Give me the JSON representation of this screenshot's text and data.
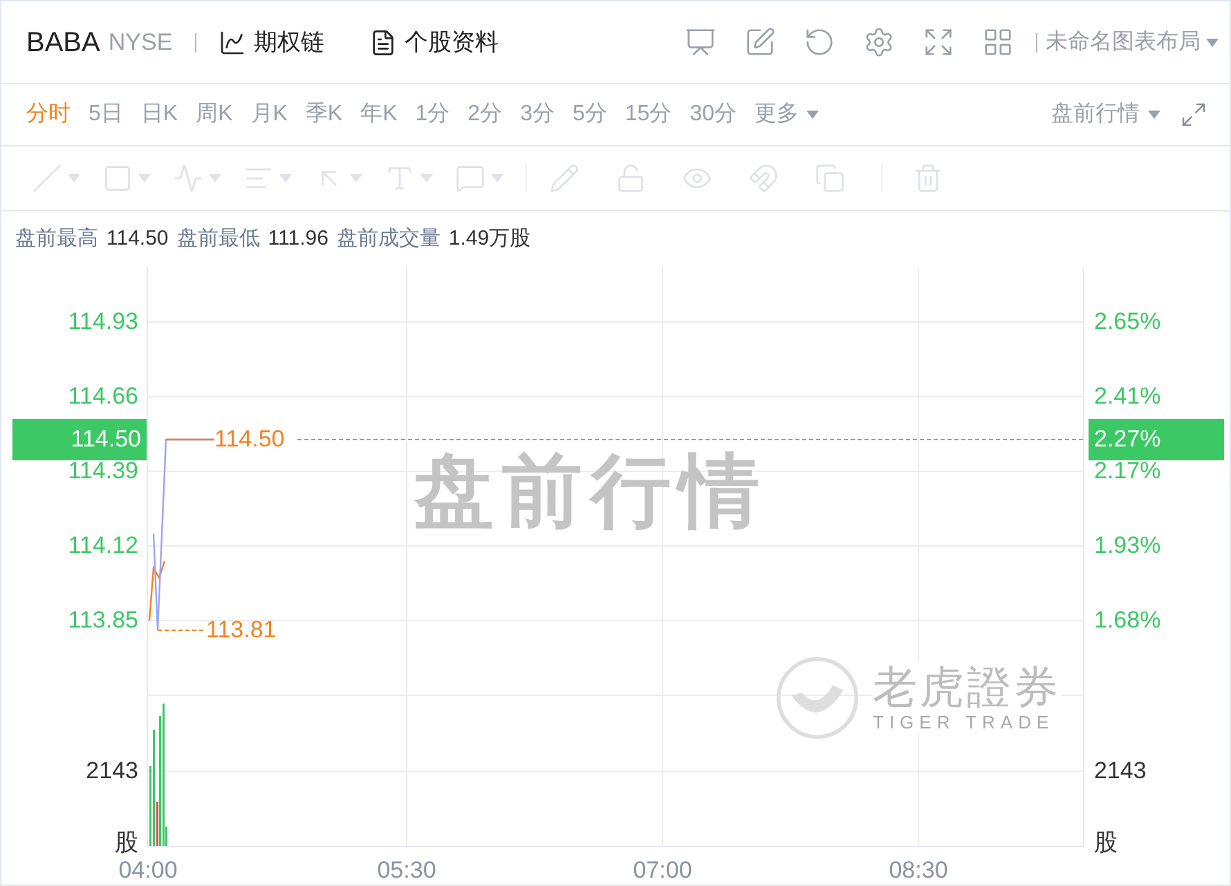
{
  "header": {
    "symbol": "BABA",
    "exchange": "NYSE",
    "links": [
      {
        "label": "期权链",
        "kind": "chain"
      },
      {
        "label": "个股资料",
        "kind": "profile"
      }
    ],
    "layout_menu": "未命名图表布局"
  },
  "periods": [
    {
      "label": "分时",
      "selected": true,
      "kind": "tab"
    },
    {
      "label": "5日",
      "selected": false,
      "kind": "tab"
    },
    {
      "label": "日K",
      "selected": false,
      "kind": "tab"
    },
    {
      "label": "周K",
      "selected": false,
      "kind": "tab"
    },
    {
      "label": "月K",
      "selected": false,
      "kind": "tab"
    },
    {
      "label": "季K",
      "selected": false,
      "kind": "tab"
    },
    {
      "label": "年K",
      "selected": false,
      "kind": "tab"
    },
    {
      "label": "1分",
      "selected": false,
      "kind": "tab"
    },
    {
      "label": "2分",
      "selected": false,
      "kind": "tab"
    },
    {
      "label": "3分",
      "selected": false,
      "kind": "tab"
    },
    {
      "label": "5分",
      "selected": false,
      "kind": "tab"
    },
    {
      "label": "15分",
      "selected": false,
      "kind": "tab"
    },
    {
      "label": "30分",
      "selected": false,
      "kind": "tab"
    },
    {
      "label": "更多",
      "selected": false,
      "kind": "menu"
    }
  ],
  "session_menu": "盘前行情",
  "drawing_toolbar": {
    "disabled": true
  },
  "info": [
    {
      "label": "盘前最高",
      "value": "114.50"
    },
    {
      "label": "盘前最低",
      "value": "111.96"
    },
    {
      "label": "盘前成交量",
      "value": "1.49万股"
    }
  ],
  "chart": {
    "watermark": "盘前行情",
    "brand": "老虎證券",
    "brand_sub": "TIGER TRADE",
    "price_ticks": [
      "114.93",
      "114.66",
      "114.39",
      "114.12",
      "113.85"
    ],
    "percent_ticks": [
      "2.65%",
      "2.41%",
      "2.17%",
      "1.93%",
      "1.68%"
    ],
    "current_price": "114.50",
    "current_percent": "2.27%",
    "high_label": "114.50",
    "low_label": "113.81",
    "left_volume": {
      "tick": "2143",
      "unit": "股"
    },
    "right_volume": {
      "tick": "2143",
      "unit": "股"
    },
    "time_ticks": [
      "04:00",
      "05:30",
      "07:00",
      "08:30"
    ]
  }
}
